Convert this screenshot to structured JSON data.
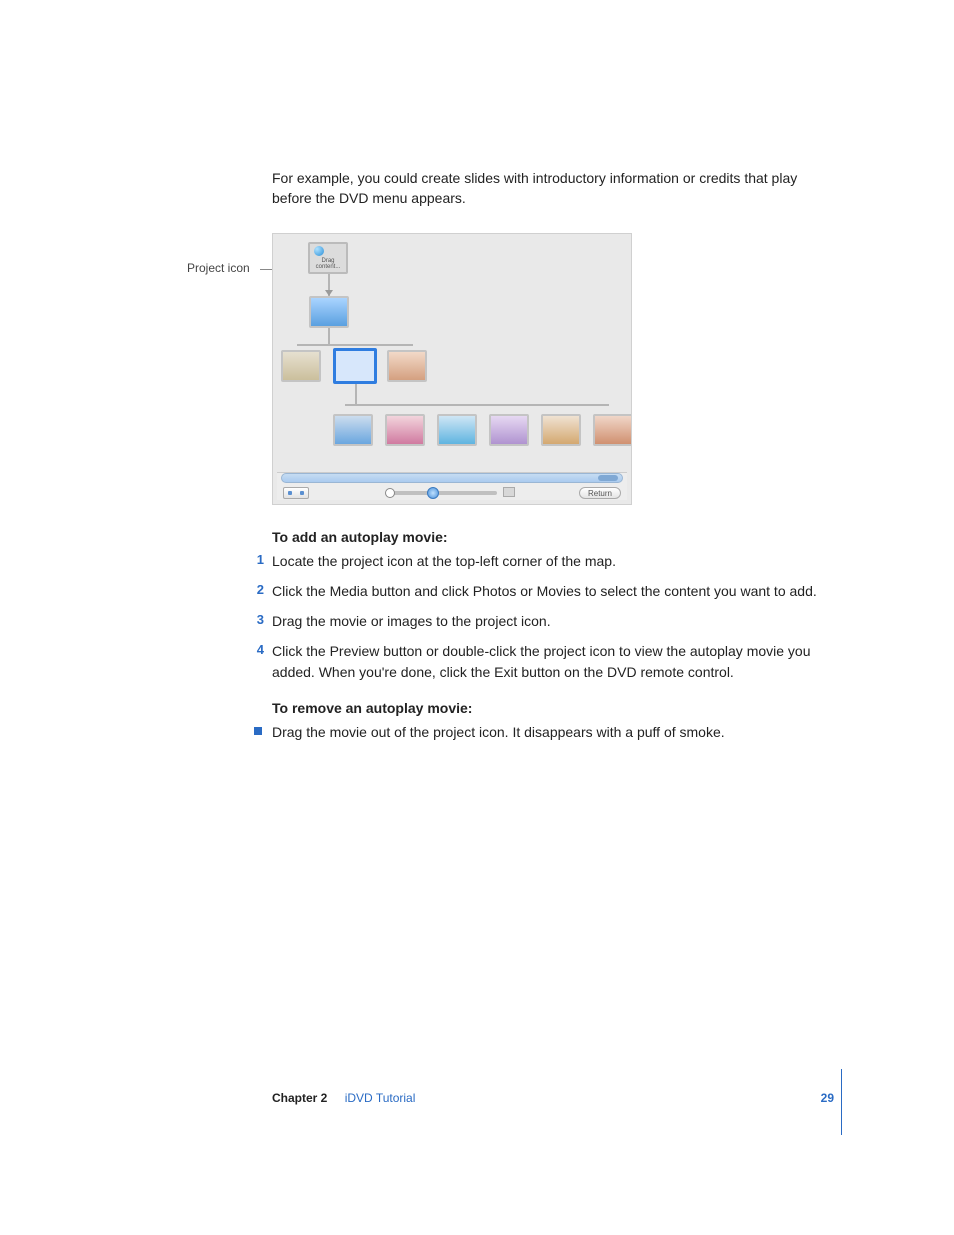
{
  "intro_para": "For example, you could create slides with introductory information or credits that play before the DVD menu appears.",
  "callout": {
    "label": "Project icon"
  },
  "screenshot": {
    "project_tile": "Drag content...",
    "return_button": "Return"
  },
  "section_add": {
    "heading": "To add an autoplay movie:",
    "steps": [
      "Locate the project icon at the top-left corner of the map.",
      "Click the Media button and click Photos or Movies to select the content you want to add.",
      "Drag the movie or images to the project icon.",
      "Click the Preview button or double-click the project icon to view the autoplay movie you added. When you're done, click the Exit button on the DVD remote control."
    ]
  },
  "section_remove": {
    "heading": "To remove an autoplay movie:",
    "bullets": [
      "Drag the movie out of the project icon. It disappears with a puff of smoke."
    ]
  },
  "footer": {
    "chapter_label": "Chapter 2",
    "title": "iDVD Tutorial",
    "page": "29"
  }
}
